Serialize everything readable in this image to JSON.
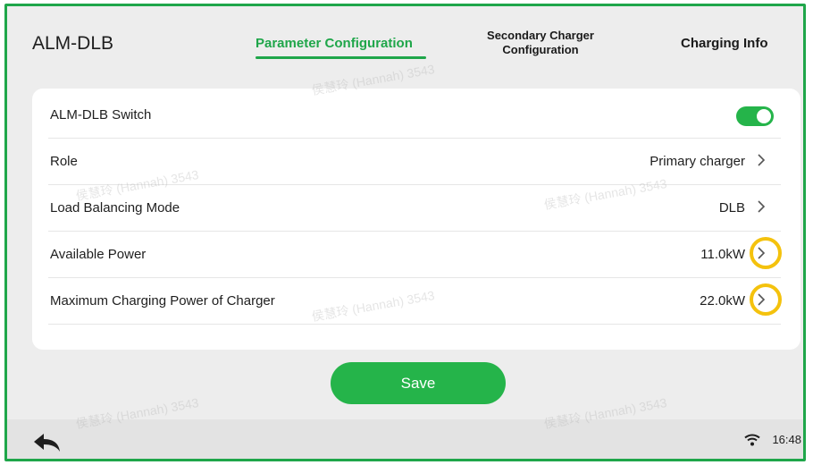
{
  "header": {
    "app_title": "ALM-DLB",
    "tabs": [
      {
        "label": "Parameter Configuration"
      },
      {
        "label_line1": "Secondary Charger",
        "label_line2": "Configuration"
      },
      {
        "label": "Charging Info"
      }
    ]
  },
  "settings": {
    "rows": [
      {
        "label": "ALM-DLB Switch",
        "toggle_on": true
      },
      {
        "label": "Role",
        "value": "Primary charger"
      },
      {
        "label": "Load Balancing Mode",
        "value": "DLB"
      },
      {
        "label": "Available Power",
        "value": "11.0kW"
      },
      {
        "label": "Maximum Charging Power of Charger",
        "value": "22.0kW"
      }
    ]
  },
  "actions": {
    "save_label": "Save"
  },
  "status_bar": {
    "time": "16:48"
  },
  "watermark": "侯慧玲 (Hannah) 3543",
  "colors": {
    "accent": "#25b44a",
    "highlight_ring": "#f4c20d",
    "frame_border": "#1fa64a"
  },
  "icons": {
    "back": "back-arrow-icon",
    "wifi": "wifi-icon",
    "chevron": "chevron-right-icon"
  }
}
